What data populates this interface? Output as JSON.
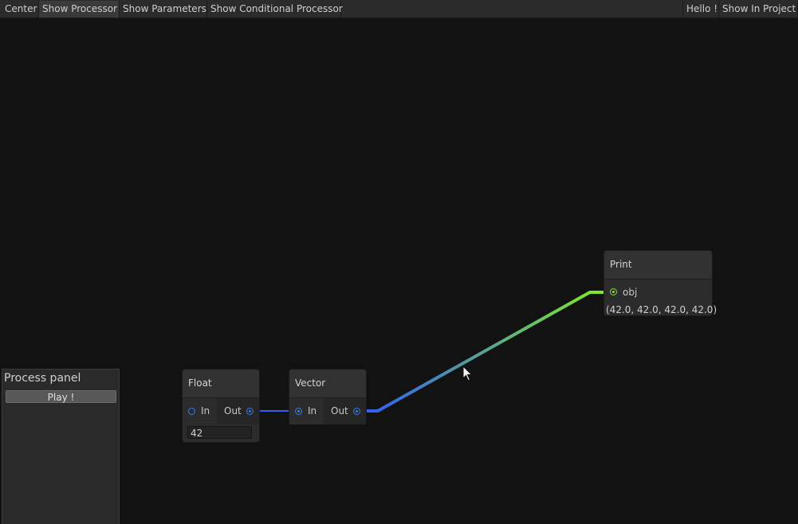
{
  "toolbar": {
    "left": [
      "Center",
      "Show Processor",
      "Show Parameters",
      "Show Conditional Processor"
    ],
    "right": [
      "Hello !",
      "Show In Project"
    ]
  },
  "nodes": {
    "float": {
      "title": "Float",
      "in_label": "In",
      "out_label": "Out",
      "value": "42"
    },
    "vector": {
      "title": "Vector",
      "in_label": "In",
      "out_label": "Out"
    },
    "print": {
      "title": "Print",
      "in_label": "obj",
      "output": "(42.0, 42.0, 42.0, 42.0)"
    }
  },
  "process_panel": {
    "title": "Process panel",
    "play_label": "Play !"
  },
  "colors": {
    "background": "#121212",
    "edge_start": "#2f5ff5",
    "edge_end": "#7fea2a",
    "port_blue": "#3b7be8",
    "port_green": "#8fdc3a"
  }
}
